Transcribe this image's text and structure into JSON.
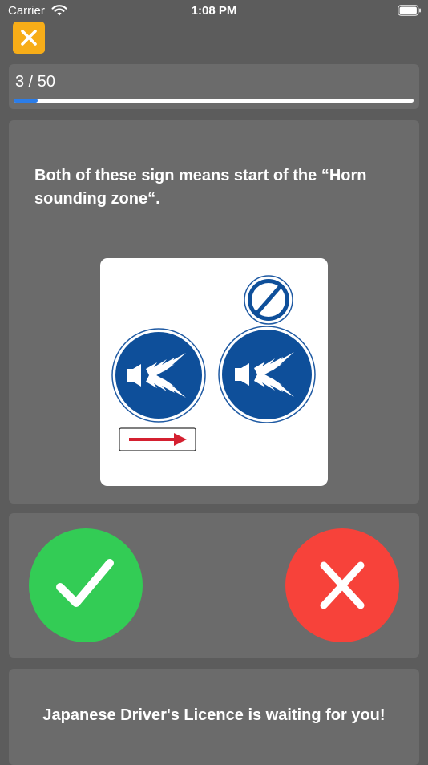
{
  "status_bar": {
    "carrier": "Carrier",
    "time": "1:08 PM"
  },
  "close_button": {
    "icon": "close-icon",
    "color": "#f7ad18"
  },
  "progress": {
    "label": "3 / 50",
    "current": 3,
    "total": 50,
    "fill_fraction": 0.06,
    "fill_color": "#2b7de9"
  },
  "question": {
    "text": "Both of these sign means start of the “Horn sounding zone“.",
    "image": {
      "icons": [
        "horn-sounding-sign-icon",
        "right-arrow-plate-icon",
        "end-restriction-sign-icon",
        "horn-sounding-sign-icon"
      ]
    }
  },
  "answers": {
    "true_icon": "checkmark-icon",
    "true_color": "#33cc55",
    "false_icon": "x-icon",
    "false_color": "#f7423a"
  },
  "footer": {
    "text": "Japanese Driver's Licence is waiting for you!"
  }
}
